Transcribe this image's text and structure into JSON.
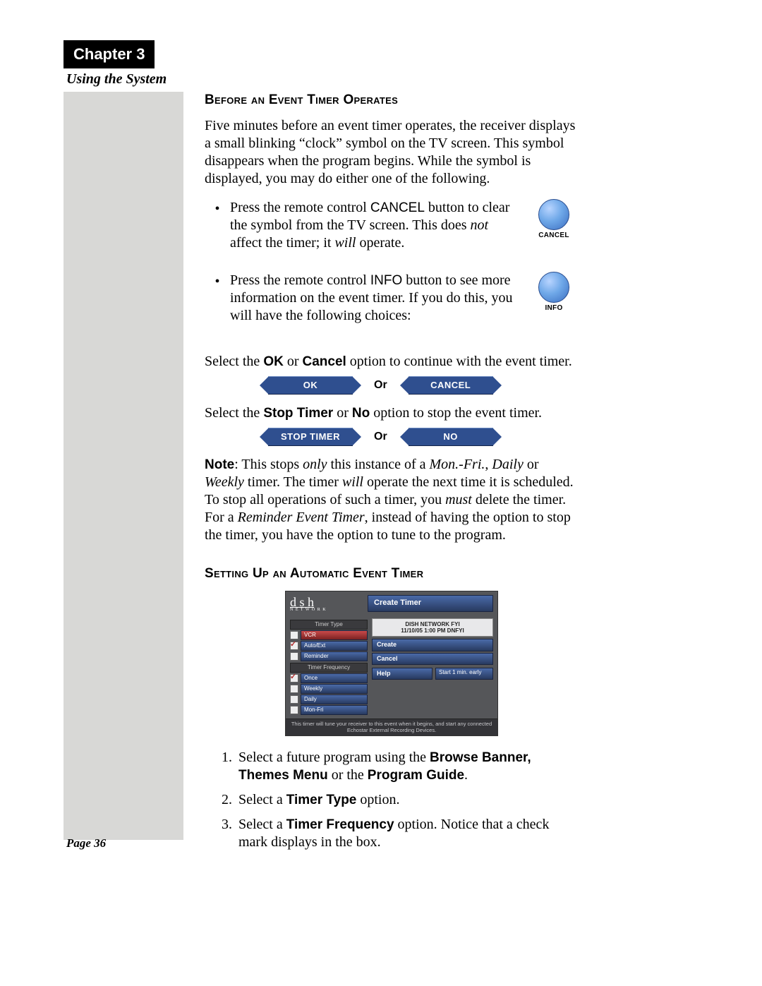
{
  "chapter_label": "Chapter 3",
  "subtitle": "Using the System",
  "page_label": "Page 36",
  "section1": {
    "heading": "Before an Event Timer Operates",
    "intro": "Five minutes before an event timer operates, the receiver displays a small blinking “clock” symbol on the TV screen. This symbol disappears when the program begins. While the symbol is displayed, you may do either one of the following.",
    "bullet1_a": "Press the remote control ",
    "bullet1_key": "CANCEL",
    "bullet1_b": " button to clear the symbol from the TV screen. This does ",
    "bullet1_em": "not",
    "bullet1_c": " affect the timer; it ",
    "bullet1_em2": "will",
    "bullet1_d": " operate.",
    "bullet2_a": "Press the remote control ",
    "bullet2_key": "INFO",
    "bullet2_b": " button to see more information on the event timer. If you do this, you will have the following choices:",
    "cancel_btn_label": "CANCEL",
    "info_btn_label": "INFO",
    "select_line1_a": "Select the ",
    "select_line1_b": " or ",
    "select_line1_c": " option to continue with the event timer.",
    "ok_bold": "OK",
    "cancel_bold": "Cancel",
    "or_label": "Or",
    "btn_ok": "OK",
    "btn_cancel": "CANCEL",
    "select_line2_a": "Select the ",
    "select_line2_b": " or ",
    "select_line2_c": " option to stop the event timer.",
    "stoptimer_bold": "Stop Timer",
    "no_bold": "No",
    "btn_stop": "STOP TIMER",
    "btn_no": "NO",
    "note_label": "Note",
    "note_a": ": This stops ",
    "note_em1": "only",
    "note_b": " this instance of a ",
    "note_em2": "Mon.-Fri.",
    "note_c": ", ",
    "note_em3": "Daily",
    "note_d": " or ",
    "note_em4": "Weekly",
    "note_e": " timer. The timer ",
    "note_em5": "will",
    "note_f": " operate the next time it is scheduled. To stop all operations of such a timer, you ",
    "note_em6": "must",
    "note_g": " delete the timer. For a ",
    "note_em7": "Reminder Event Timer",
    "note_h": ", instead of having the option to stop the timer, you have the option to tune to the program."
  },
  "section2": {
    "heading": "Setting Up an Automatic Event Timer",
    "screenshot": {
      "logo_main": "d s h",
      "logo_sub": "N E T W O R K",
      "title": "Create Timer",
      "grp_type": "Timer Type",
      "type_opts": [
        "VCR",
        "Auto/Ext",
        "Reminder"
      ],
      "grp_freq": "Timer Frequency",
      "freq_opts": [
        "Once",
        "Weekly",
        "Daily",
        "Mon-Fri"
      ],
      "info_line1": "DISH NETWORK FYI",
      "info_line2": "11/10/05  1:00 PM  DNFYI",
      "actions": [
        "Create",
        "Cancel",
        "Help"
      ],
      "early_btn": "Start 1 min. early",
      "footer": "This timer will tune your receiver to this event when it begins, and start any connected Echostar External Recording Devices."
    },
    "step1_a": "Select a future program using the ",
    "step1_bold": "Browse Banner, Themes Menu",
    "step1_b": " or the ",
    "step1_bold2": "Program Guide",
    "step1_c": ".",
    "step2_a": "Select a ",
    "step2_bold": "Timer Type",
    "step2_b": " option.",
    "step3_a": "Select a ",
    "step3_bold": "Timer Frequency",
    "step3_b": " option. Notice that a check mark displays in the box."
  }
}
